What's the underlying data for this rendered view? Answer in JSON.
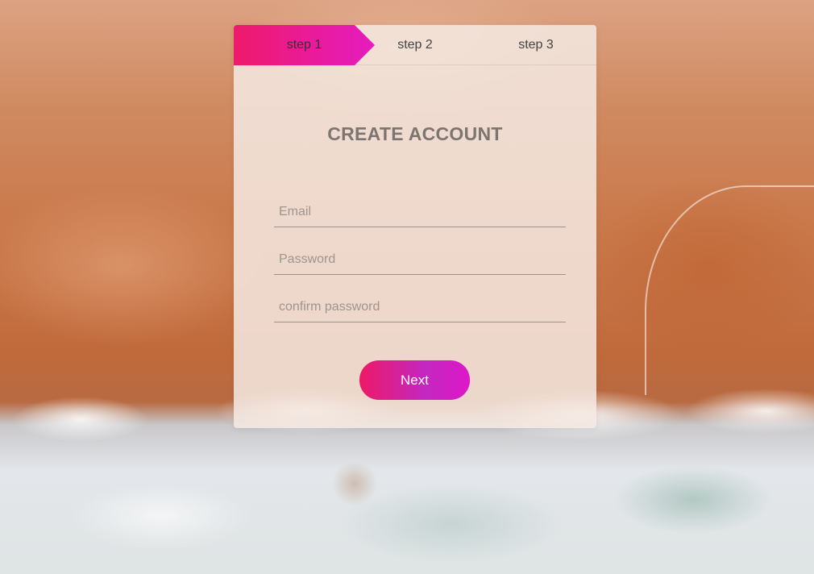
{
  "steps": [
    {
      "label": "step 1",
      "active": true
    },
    {
      "label": "step 2",
      "active": false
    },
    {
      "label": "step 3",
      "active": false
    }
  ],
  "form": {
    "title": "CREATE ACCOUNT",
    "email_placeholder": "Email",
    "email_value": "",
    "password_placeholder": "Password",
    "password_value": "",
    "confirm_placeholder": "confirm password",
    "confirm_value": "",
    "next_label": "Next"
  },
  "colors": {
    "accent_start": "#ec1a67",
    "accent_end": "#dd18c8",
    "title": "#7d7570"
  }
}
